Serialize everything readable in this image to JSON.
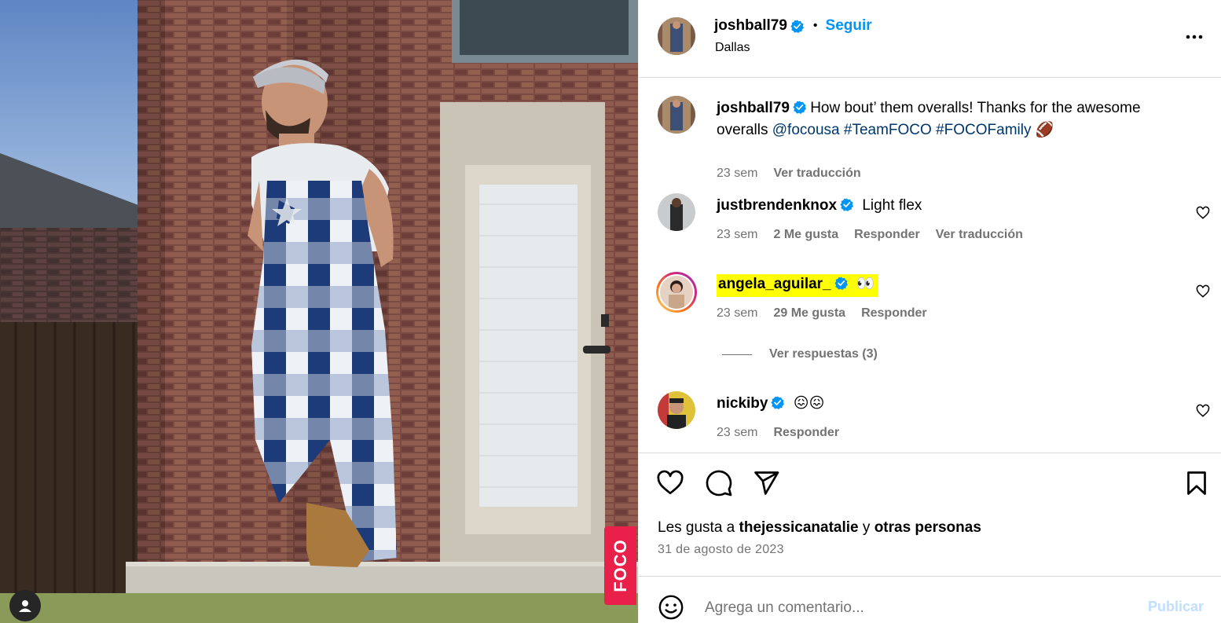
{
  "post": {
    "author": "joshball79",
    "follow_label": "Seguir",
    "dot": "•",
    "location": "Dallas",
    "more_icon": "more-options-icon",
    "media_tag": "FOCO"
  },
  "caption": {
    "author": "joshball79",
    "text_before": "How bout’ them overalls! Thanks for the awesome overalls ",
    "mention": "@focousa",
    "hashtag1": "#TeamFOCO",
    "hashtag2": "#FOCOFamily",
    "emoji": "🏈",
    "time": "23 sem",
    "translate": "Ver traducción"
  },
  "comments": [
    {
      "username": "justbrendenknox",
      "text": "Light flex",
      "time": "23 sem",
      "likes": "2 Me gusta",
      "reply": "Responder",
      "translate": "Ver traducción"
    },
    {
      "username": "angela_aguilar_",
      "text": "👀",
      "time": "23 sem",
      "likes": "29 Me gusta",
      "reply": "Responder",
      "view_replies": "Ver respuestas (3)",
      "highlight_color": "#ffff00"
    },
    {
      "username": "nickiby",
      "text": "😖😖",
      "time": "23 sem",
      "reply": "Responder"
    }
  ],
  "actions": {
    "likes_prefix": "Les gusta a ",
    "likes_user": "thejessicanatalie",
    "likes_join": " y ",
    "likes_rest": "otras personas",
    "date": "31 de agosto de 2023"
  },
  "composer": {
    "placeholder": "Agrega un comentario...",
    "publish": "Publicar"
  },
  "colors": {
    "accent": "#0095f6",
    "verified": "#0095f6",
    "secondary_text": "#737373",
    "foco_red": "#e8204a"
  }
}
